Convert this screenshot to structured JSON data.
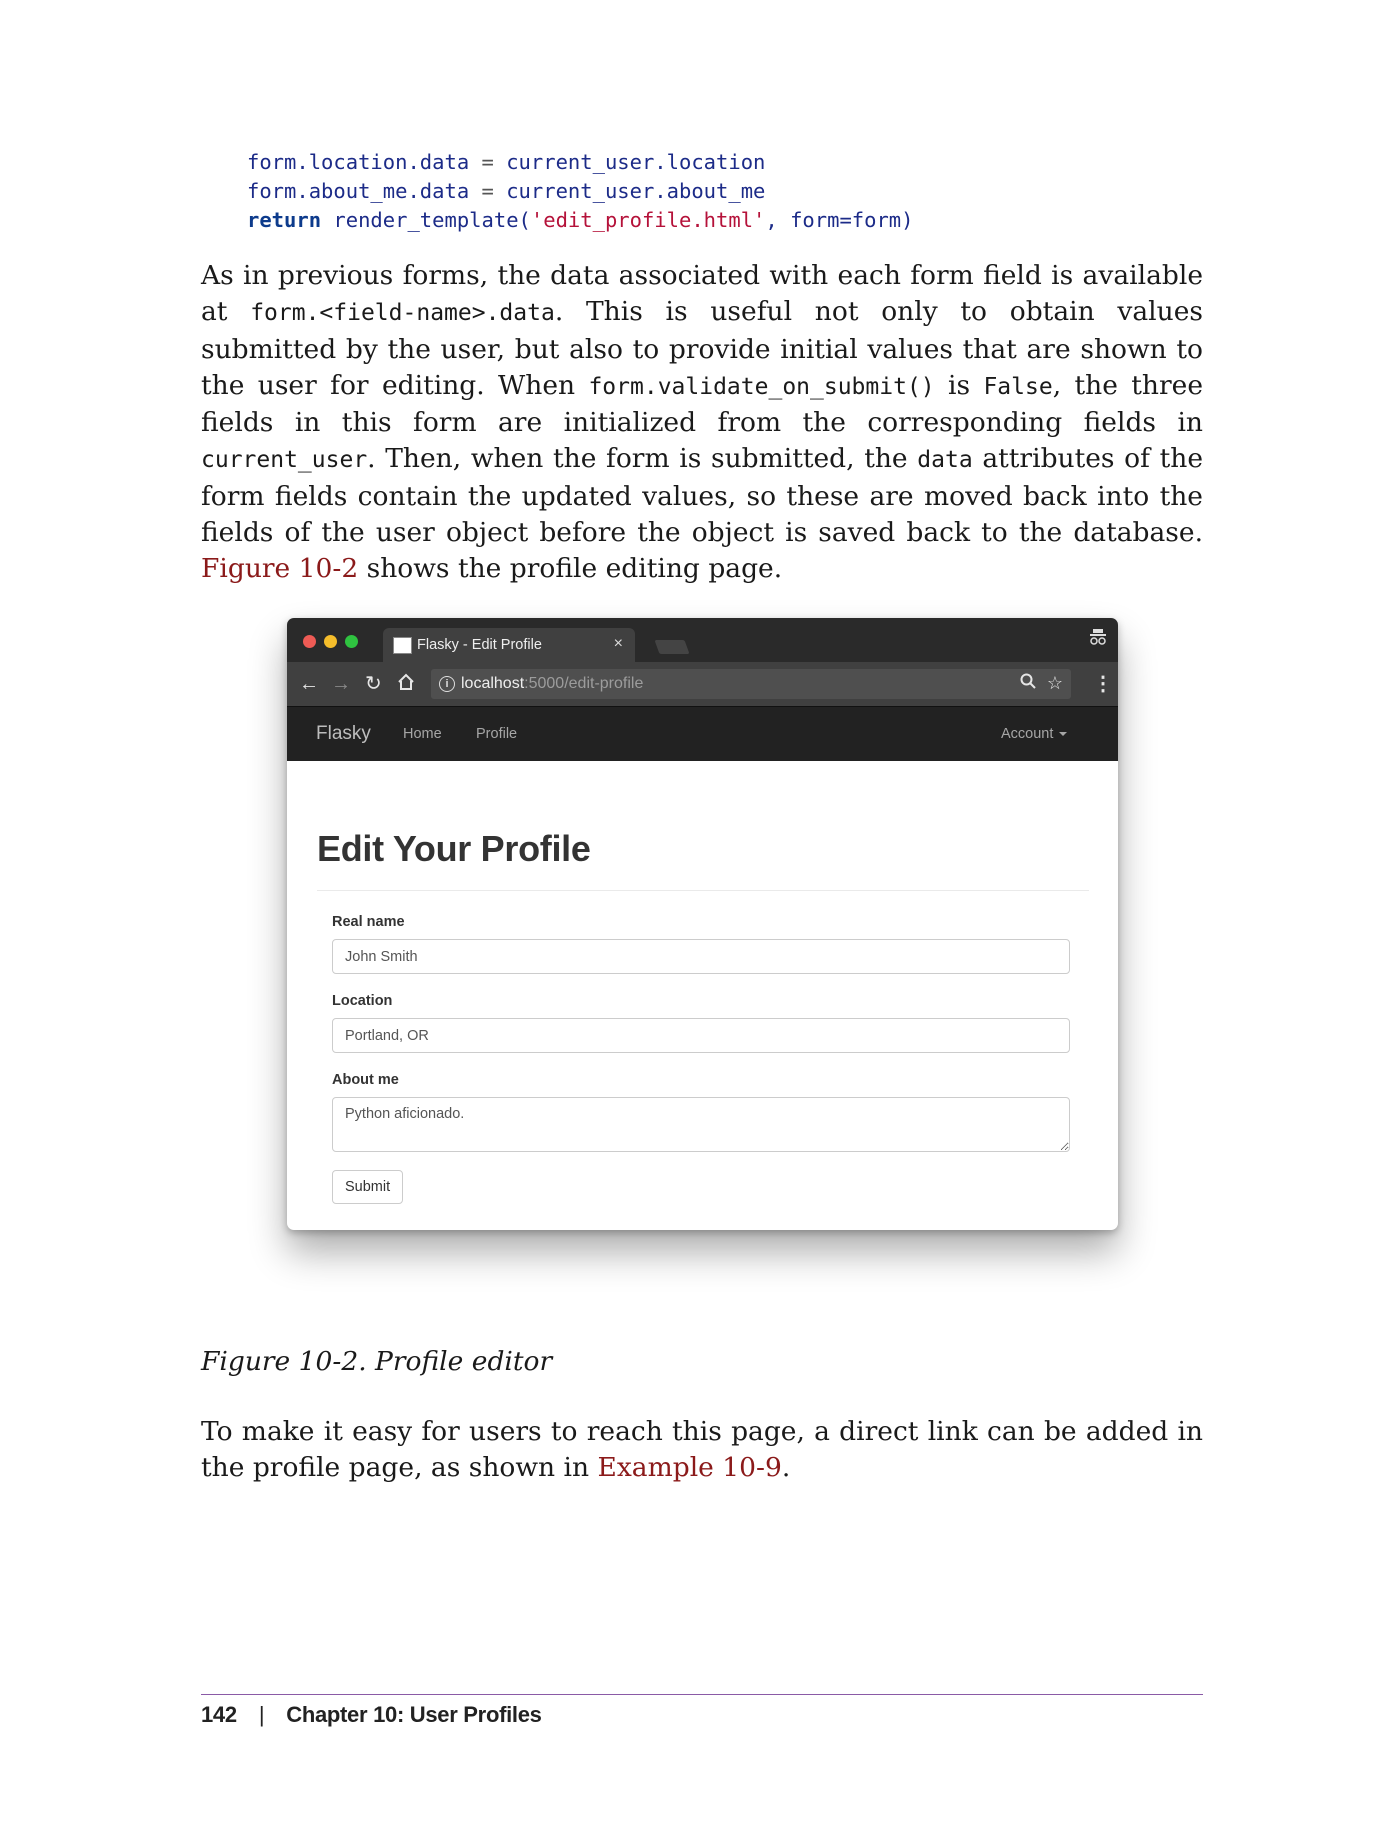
{
  "code": {
    "line1": {
      "lhs": "form.location.data",
      "op": " = ",
      "rhs": "current_user.location"
    },
    "line2": {
      "lhs": "form.about_me.data",
      "op": " = ",
      "rhs": "current_user.about_me"
    },
    "line3": {
      "kw": "return",
      "fn": " render_template(",
      "str": "'edit_profile.html'",
      "rest": ", form=form)"
    }
  },
  "para1": {
    "t1": "As in previous forms, the data associated with each form field is available at ",
    "c1": "form.<field-name>.data",
    "t2": ". This is useful not only to obtain values submitted by the user, but also to provide initial values that are shown to the user for editing. When ",
    "c2": "form.validate_on_submit()",
    "t3": " is ",
    "c3": "False",
    "t4": ", the three fields in this form are initialized from the corresponding fields in ",
    "c4": "current_user",
    "t5": ". Then, when the form is submitted, the ",
    "c5": "data",
    "t6": " attributes of the form fields contain the updated values, so these are moved back into the fields of the user object before the object is saved back to the database. ",
    "link": "Figure 10-2",
    "t7": " shows the profile editing page."
  },
  "figure": {
    "tab_title": "Flasky - Edit Profile",
    "tab_close": "×",
    "url_host": "localhost",
    "url_path": ":5000/edit-profile",
    "nav": {
      "brand": "Flasky",
      "home": "Home",
      "profile": "Profile",
      "account": "Account"
    },
    "heading": "Edit Your Profile",
    "fields": {
      "real_name_label": "Real name",
      "real_name_value": "John Smith",
      "location_label": "Location",
      "location_value": "Portland, OR",
      "about_label": "About me",
      "about_value": "Python aficionado."
    },
    "submit_label": "Submit",
    "icons": [
      "incognito-icon",
      "back-icon",
      "forward-icon",
      "reload-icon",
      "home-icon",
      "info-icon",
      "zoom-icon",
      "star-icon",
      "menu-icon"
    ]
  },
  "caption": "Figure 10-2. Profile editor",
  "para2": {
    "t1": "To make it easy for users to reach this page, a direct link can be added in the profile page, as shown in ",
    "link": "Example 10-9",
    "t2": "."
  },
  "footer": {
    "page": "142",
    "sep": "|",
    "chapter": "Chapter 10: User Profiles"
  }
}
